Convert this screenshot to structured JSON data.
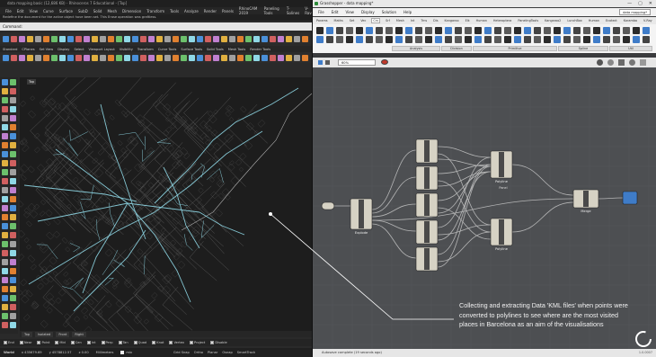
{
  "rhino": {
    "title": "data mapping basic (12,686 KB) - Rhinoceros 7 Educational - [Top]",
    "menu": [
      "File",
      "Edit",
      "View",
      "Curve",
      "Surface",
      "SubD",
      "Solid",
      "Mesh",
      "Dimension",
      "Transform",
      "Tools",
      "Analyze",
      "Render",
      "Panels",
      "RhinoCAM 2019",
      "Paneling Tools",
      "T-Splines",
      "V-Ray"
    ],
    "message": "Redefine the document for the active object hove been set. This Erase operation was graftless.",
    "command_label": "Command:",
    "tabs": [
      "Standard",
      "CPlanes",
      "Set View",
      "Display",
      "Select",
      "Viewport Layout",
      "Visibility",
      "Transform",
      "Curve Tools",
      "Surface Tools",
      "Solid Tools",
      "Mesh Tools",
      "Render Tools"
    ],
    "viewport_label": "Top",
    "viewport_tabs": [
      "Top",
      "Isolated",
      "Front",
      "Right"
    ],
    "osnap": [
      "End",
      "Near",
      "Point",
      "Mid",
      "Cen",
      "Int",
      "Perp",
      "Tan",
      "Quad",
      "Knot",
      "Vertex",
      "Project",
      "Disable"
    ],
    "status": {
      "view": "World",
      "x": "x 435679.69",
      "y": "y 4578812.57",
      "z": "z 0.00",
      "units": "Millimeters",
      "layer": "mix",
      "toggles": [
        "Grid Snap",
        "Ortho",
        "Planar",
        "Osnap",
        "SmartTrack"
      ]
    }
  },
  "grasshopper": {
    "title": "Grasshopper - data mapping*",
    "window_buttons": [
      "—",
      "▢",
      "✕"
    ],
    "menu": [
      "File",
      "Edit",
      "View",
      "Display",
      "Solution",
      "Help"
    ],
    "doc_name": "data mapping*",
    "tabs": [
      "Params",
      "Maths",
      "Set",
      "Vec",
      "Crv",
      "Srf",
      "Mesh",
      "Int",
      "Trns",
      "Dis",
      "Kangaroo",
      "Elk",
      "Human",
      "Heteroptera",
      "PanelingTools",
      "Kangaroo2",
      "LunchBox",
      "Human",
      "Ecotect",
      "Karamba",
      "V-Ray"
    ],
    "active_tab": "Crv",
    "groups": [
      "Analysis",
      "Division",
      "Primitive",
      "Spline",
      "Util"
    ],
    "zoom": "60%",
    "status": "Autosave complete (19 seconds ago)",
    "version": "1.0.0007"
  },
  "canvas": {
    "panel_label": "Panel",
    "component_labels": [
      "Explode",
      "Polyline",
      "Polyline",
      "Merge"
    ]
  },
  "annotation": "Collecting and extracting Data 'KML files' when points were converted to polylines to see where are the most visited places in Barcelona as an aim of the visualisations",
  "colors": {
    "map_lines": "#8fd8e6",
    "map_bg": "#1d1d1d",
    "gh_canvas": "#4d4f52",
    "component_fill": "#d6d2c4",
    "accent_blue": "#3f7cc8"
  },
  "icons": [
    "rhino-logo-icon",
    "grasshopper-logo-icon",
    "minimize-icon",
    "maximize-icon",
    "close-icon",
    "eye-icon",
    "save-icon",
    "spinner-icon"
  ]
}
